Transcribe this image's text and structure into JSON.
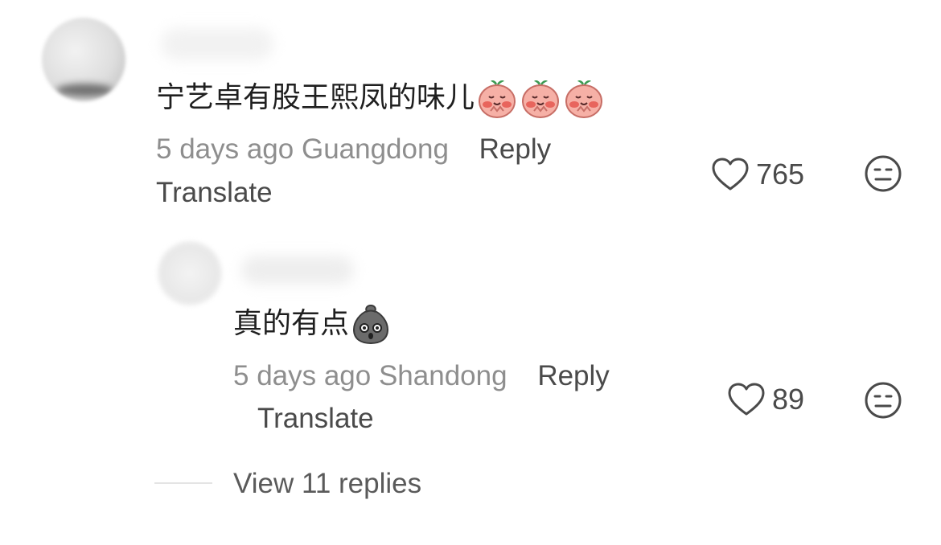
{
  "comment": {
    "text": "宁艺卓有股王熙凤的味儿",
    "emojis": [
      "blushing-peach-emoji",
      "blushing-peach-emoji",
      "blushing-peach-emoji"
    ],
    "meta": "5 days ago Guangdong",
    "reply_label": "Reply",
    "translate_label": "Translate",
    "likes": "765"
  },
  "reply": {
    "text": "真的有点",
    "emoji": "shocked-bag-emoji",
    "meta": "5 days ago Shandong",
    "reply_label": "Reply",
    "translate_label": "Translate",
    "likes": "89"
  },
  "view_replies_label": "View 11 replies",
  "colors": {
    "text_primary": "#1f1f1f",
    "text_secondary": "#8e8e8e",
    "action_text": "#4a4a4a",
    "peach_emoji": "#f2a39b",
    "bag_emoji": "#6b6b6b"
  }
}
